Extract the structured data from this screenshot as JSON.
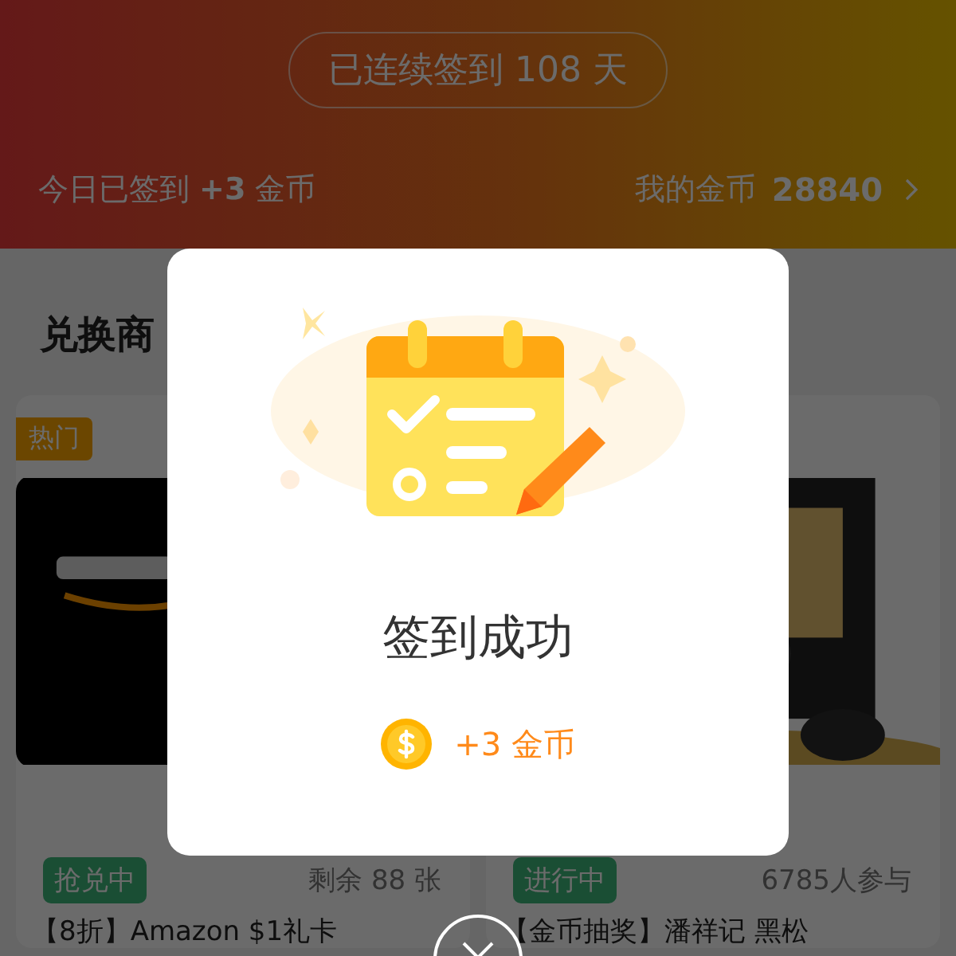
{
  "header": {
    "streak": "已连续签到 108 天",
    "today": "今日已签到 **+3** 金币",
    "coins_label": "我的金币",
    "coins": "28840"
  },
  "section": {
    "title": "兑换商"
  },
  "products": [
    {
      "tag": "热门",
      "status": "抢兑中",
      "meta": "剩余 88 张",
      "title": "【8折】Amazon $1礼卡"
    },
    {
      "status": "进行中",
      "meta": "6785人参与",
      "title": "【金币抽奖】潘祥记 黑松"
    }
  ],
  "modal": {
    "title": "签到成功",
    "reward": "+3 金币"
  }
}
